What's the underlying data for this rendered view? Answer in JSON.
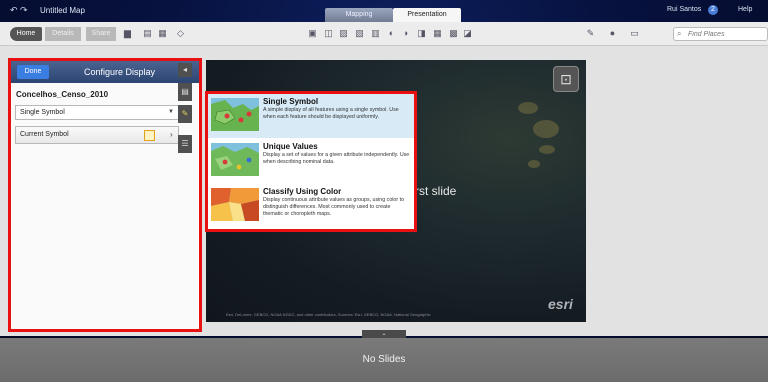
{
  "titlebar": {
    "undo_icons": "↶ ↷",
    "title": "Untitled Map",
    "tabs": [
      {
        "label": "Mapping"
      },
      {
        "label": "Presentation"
      }
    ],
    "user": "Rui Santos",
    "notifications": "2",
    "help": "Help"
  },
  "toolbar": {
    "home": "Home",
    "details": "Details",
    "share": "Share",
    "find_placeholder": "Find Places"
  },
  "panel": {
    "done": "Done",
    "title": "Configure Display",
    "layer_name": "Concelhos_Censo_2010",
    "symbol_type": "Single Symbol",
    "current_symbol": "Current Symbol"
  },
  "dropdown": {
    "options": [
      {
        "title": "Single Symbol",
        "description": "A simple display of all features using a single symbol. Use when each feature should be displayed uniformly."
      },
      {
        "title": "Unique Values",
        "description": "Display a set of values for a given attribute independently.  Use when describing nominal data."
      },
      {
        "title": "Classify Using Color",
        "description": "Display continuous attribute values as groups, using color to distinguish differences. Most commonly used to create thematic or choropleth maps."
      }
    ]
  },
  "map": {
    "caption": "first slide",
    "logo": "esri",
    "attribution": "Esri, DeLorme, GEBCO, NOAA NGDC, and other contributors, Sources: Esri, GEBCO, NOAA, National Geographic"
  },
  "slides": {
    "empty_message": "No Slides"
  },
  "colors": {
    "accent": "#3b7ee2",
    "highlight": "#e81010",
    "header": "#2d4571"
  }
}
